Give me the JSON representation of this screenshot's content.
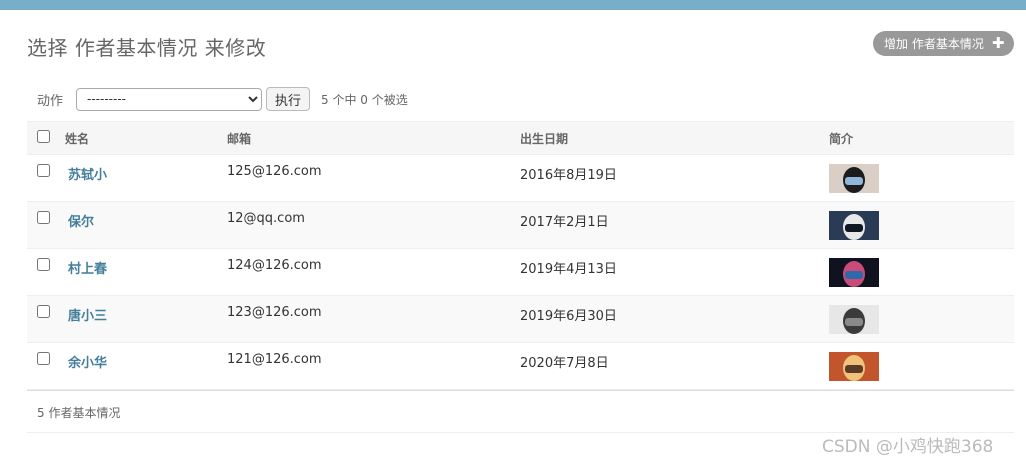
{
  "page": {
    "title": "选择 作者基本情况 来修改",
    "add_button_label": "增加 作者基本情况",
    "add_button_icon": "plus-icon"
  },
  "actions": {
    "label": "动作",
    "select_value": "---------",
    "run_button": "执行",
    "selection_counter": "5 个中 0 个被选"
  },
  "table": {
    "headers": [
      "姓名",
      "邮箱",
      "出生日期",
      "简介"
    ],
    "rows": [
      {
        "name": "苏轼小",
        "email": "125@126.com",
        "birth": "2016年8月19日",
        "thumb_colors": [
          "#d9cfc6",
          "#1c1c1c",
          "#8fb7d8"
        ]
      },
      {
        "name": "保尔",
        "email": "12@qq.com",
        "birth": "2017年2月1日",
        "thumb_colors": [
          "#2a3b55",
          "#e8e8e8",
          "#0f1723"
        ]
      },
      {
        "name": "村上春",
        "email": "124@126.com",
        "birth": "2019年4月13日",
        "thumb_colors": [
          "#10131f",
          "#c94b7a",
          "#2e6aa8"
        ]
      },
      {
        "name": "唐小三",
        "email": "123@126.com",
        "birth": "2019年6月30日",
        "thumb_colors": [
          "#e7e7e7",
          "#3b3b3b",
          "#8a8a8a"
        ]
      },
      {
        "name": "余小华",
        "email": "121@126.com",
        "birth": "2020年7月8日",
        "thumb_colors": [
          "#c2552b",
          "#f0c27a",
          "#5a3b2a"
        ]
      }
    ]
  },
  "footer": {
    "count_text": "5 作者基本情况"
  },
  "watermark": "CSDN @小鸡快跑368",
  "colors": {
    "topbar": "#79aec8",
    "link": "#447e9b",
    "add_button": "#999999"
  }
}
